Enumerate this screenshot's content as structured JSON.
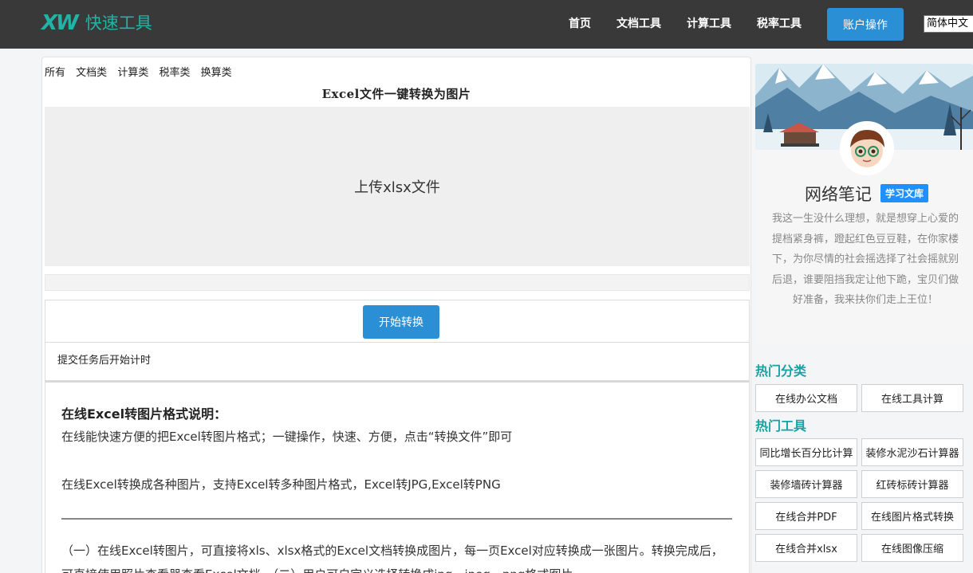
{
  "header": {
    "logo_mark": "XW",
    "logo_text": "快速工具",
    "nav": [
      "首页",
      "文档工具",
      "计算工具",
      "税率工具"
    ],
    "account_button": "账户操作",
    "language": "简体中文"
  },
  "main": {
    "categories": [
      "所有",
      "文档类",
      "计算类",
      "税率类",
      "换算类"
    ],
    "title": "Excel文件一键转换为图片",
    "upload_label": "上传xlsx文件",
    "start_button": "开始转换",
    "timer_text": "提交任务后开始计时",
    "description": {
      "heading": "在线Excel转图片格式说明：",
      "line1": "在线能快速方便的把Excel转图片格式；一键操作，快速、方便，点击“转换文件”即可",
      "line2": "在线Excel转换成各种图片，支持Excel转多种图片格式，Excel转JPG,Excel转PNG",
      "long": "（一）在线Excel转图片，可直接将xls、xlsx格式的Excel文档转换成图片，每一页Excel对应转换成一张图片。转换完成后，可直接使用照片查看器查看Excel文档。（二）用户可自定义选择转换成jpg、jpeg、png格式图片。"
    }
  },
  "sidebar": {
    "profile": {
      "name": "网络笔记",
      "tag": "学习文库",
      "bio": "我这一生没什么理想，就是想穿上心爱的提档紧身裤，蹬起红色豆豆鞋，在你家楼下，为你尽情的社会摇选择了社会摇就别后退，谁要阻挡我定让他下跪，宝贝们做好准备，我来扶你们走上王位！"
    },
    "hot_categories_title": "热门分类",
    "hot_categories": [
      "在线办公文档",
      "在线工具计算"
    ],
    "hot_tools_title": "热门工具",
    "hot_tools": [
      "同比增长百分比计算",
      "装修水泥沙石计算器",
      "装修墙砖计算器",
      "红砖标砖计算器",
      "在线合并PDF",
      "在线图片格式转换",
      "在线合并xlsx",
      "在线图像压缩"
    ]
  },
  "colors": {
    "header_bg": "#393939",
    "brand": "#23b3a6",
    "primary_button": "#2b8fd6",
    "section_title": "#17a2a2",
    "tag_blue": "#1e90ff"
  }
}
